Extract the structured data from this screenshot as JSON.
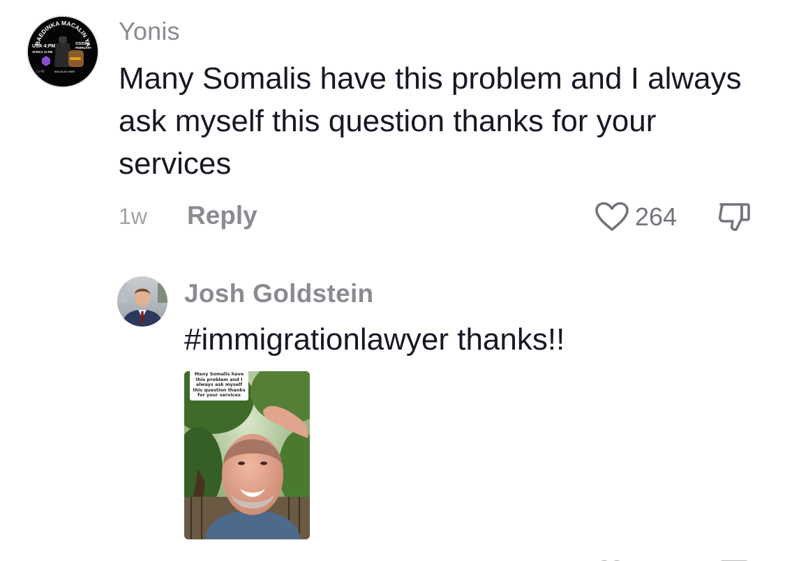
{
  "main_comment": {
    "username": "Yonis",
    "text": "Many Somalis have this problem and I always ask myself this question thanks for your services",
    "time": "1w",
    "reply_label": "Reply",
    "like_count": "264",
    "like_icon": "heart-outline-icon",
    "dislike_icon": "thumbs-down-outline-icon",
    "avatar_text": {
      "top": "BAEDINKA MACALIN YARE",
      "left": "USA 4:PM",
      "left2": "AFRICA 12:PM",
      "right": "2/3/2024",
      "right2": "FEBRUARY",
      "badge": "Lv.40",
      "bottom": "MACALIN YARE"
    }
  },
  "reply_comment": {
    "username": "Josh Goldstein",
    "text": "#immigrationlawyer thanks!!",
    "video_caption": "Many Somalis have this problem and I always ask myself this question thanks for your services"
  },
  "colors": {
    "text_primary": "#161823",
    "text_secondary": "#8a8b91",
    "background": "#ffffff"
  }
}
